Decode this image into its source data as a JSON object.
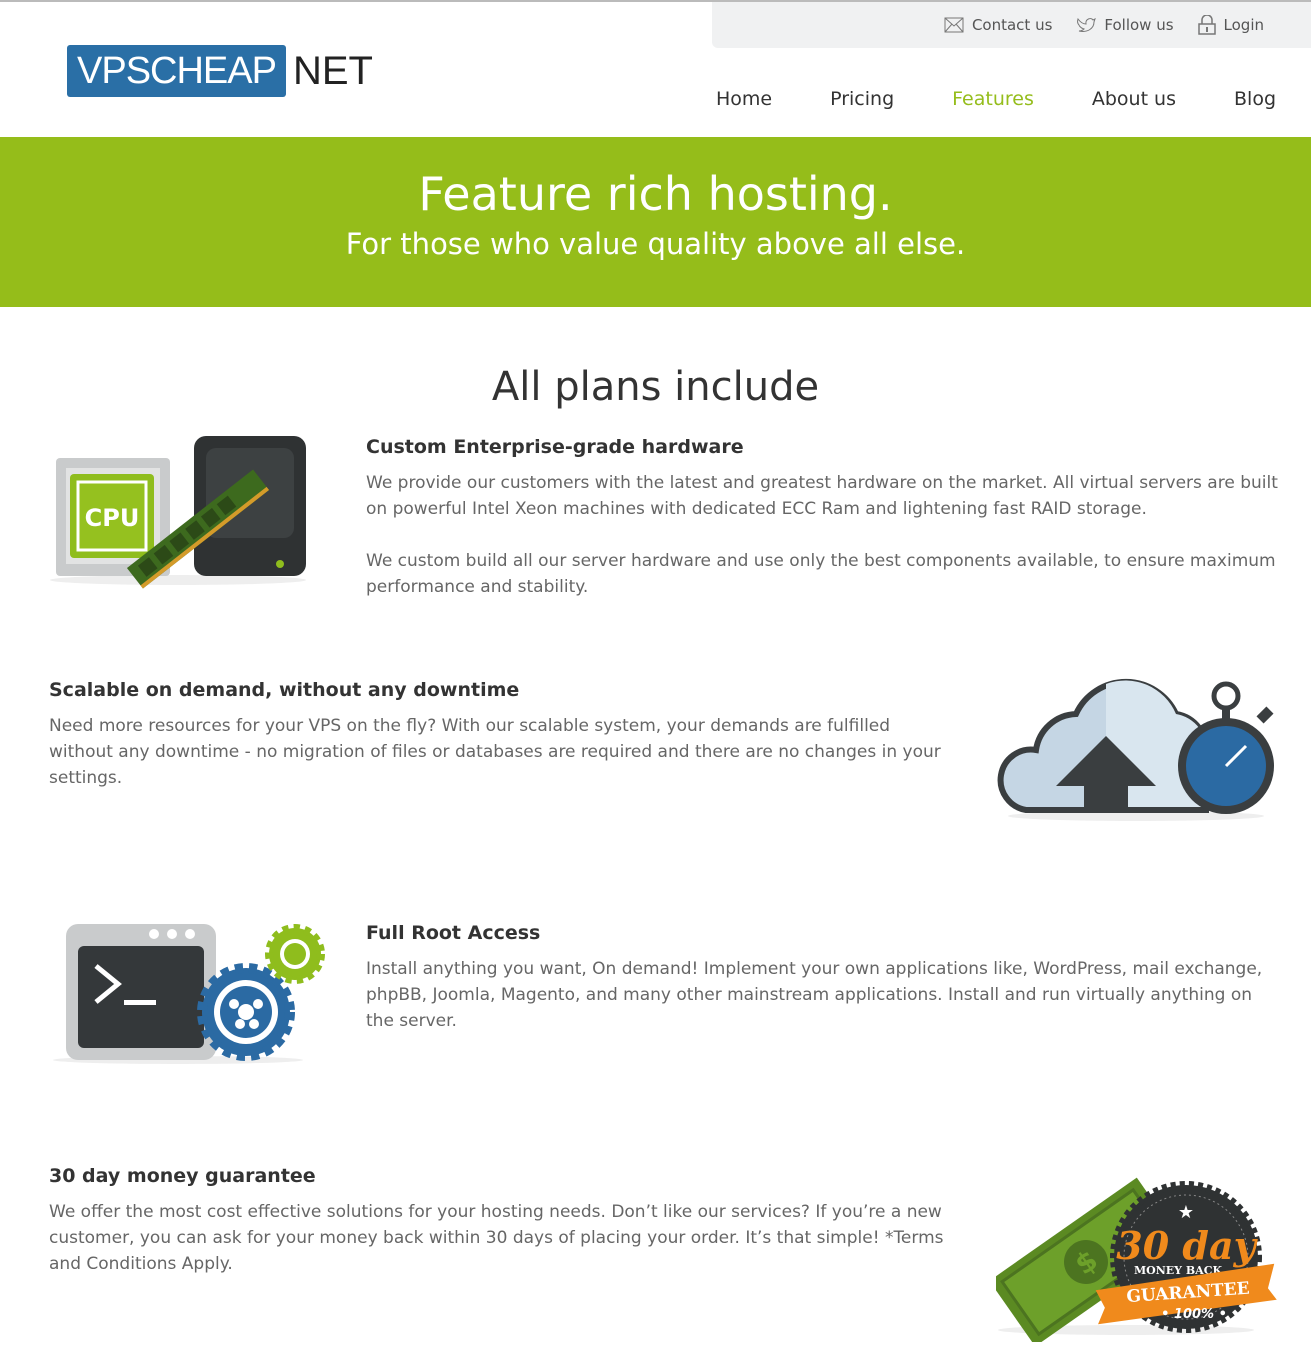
{
  "topbar": {
    "contact": "Contact us",
    "follow": "Follow us",
    "login": "Login"
  },
  "logo": {
    "box": "VPSCHEAP",
    "suffix": "NET"
  },
  "nav": [
    "Home",
    "Pricing",
    "Features",
    "About us",
    "Blog"
  ],
  "nav_active": "Features",
  "colors": {
    "accent": "#95bd1a",
    "logo_blue": "#2a6fa6"
  },
  "hero": {
    "title": "Feature rich hosting.",
    "subtitle": "For those who value quality above all else."
  },
  "section_title": "All plans include",
  "features": [
    {
      "title": "Custom Enterprise-grade hardware",
      "paragraphs": [
        "We provide our customers with the latest and greatest hardware on the market. All virtual servers are built on powerful Intel Xeon machines with dedicated ECC Ram and lightening fast RAID storage.",
        "We custom build all our server hardware and use only the best components available, to ensure maximum performance and stability."
      ],
      "icon": "cpu-ram-server-icon",
      "icon_label": "CPU"
    },
    {
      "title": "Scalable on demand, without any downtime",
      "paragraphs": [
        "Need more resources for your VPS on the fly? With our scalable system, your demands are fulfilled without any downtime - no migration of files or databases are required and there are no changes in your settings."
      ],
      "icon": "cloud-stopwatch-icon"
    },
    {
      "title": "Full Root Access",
      "paragraphs": [
        "Install anything you want, On demand! Implement your own applications like, WordPress, mail exchange, phpBB, Joomla, Magento, and many other mainstream applications. Install and run virtually anything on the server."
      ],
      "icon": "terminal-gears-icon",
      "icon_label": ">_"
    },
    {
      "title": "30 day money guarantee",
      "paragraphs": [
        "We offer the most cost effective solutions for your hosting needs. Don’t like our services? If you’re a new customer, you can ask for your money back within 30 days of placing your order. It’s that simple! *Terms and Conditions Apply."
      ],
      "icon": "money-back-badge-icon",
      "badge": {
        "days": "30 day",
        "money_back": "MONEY BACK",
        "guarantee": "GUARANTEE",
        "percent": "• 100% •"
      }
    }
  ]
}
